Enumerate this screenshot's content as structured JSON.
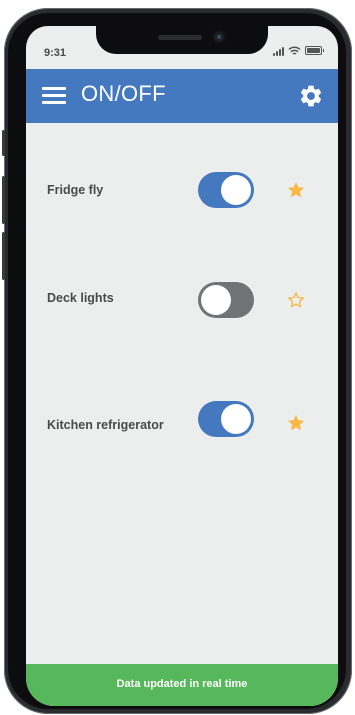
{
  "status_bar": {
    "time": "9:31"
  },
  "header": {
    "title": "ON/OFF",
    "menu_icon": "hamburger-menu-icon",
    "settings_icon": "gear-icon",
    "background": "#4479c0"
  },
  "devices": [
    {
      "label": "Fridge fly",
      "on": true,
      "favorite": true
    },
    {
      "label": "Deck lights",
      "on": false,
      "favorite": false
    },
    {
      "label": "Kitchen refrigerator",
      "on": true,
      "favorite": true
    }
  ],
  "colors": {
    "toggle_on": "#4479c0",
    "toggle_off": "#727375",
    "star": "#f7b944",
    "footer": "#56b85a"
  },
  "footer": {
    "message": "Data updated in real time"
  }
}
